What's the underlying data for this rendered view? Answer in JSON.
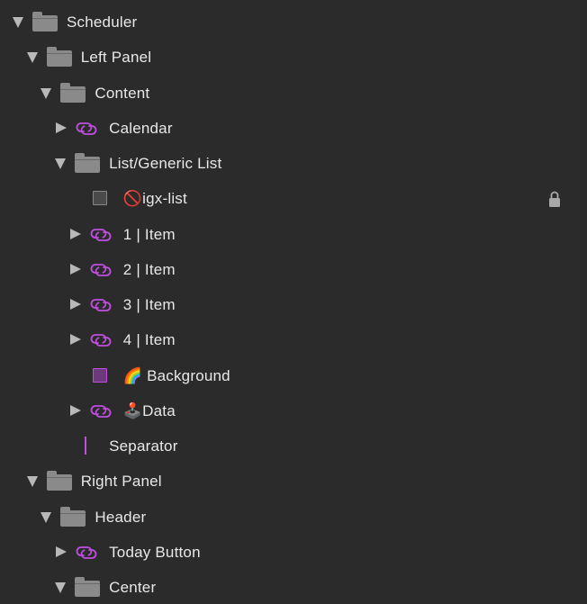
{
  "layers": [
    {
      "label": "Scheduler",
      "type": "folder",
      "state": "expanded",
      "level": 0
    },
    {
      "label": "Left Panel",
      "type": "folder",
      "state": "expanded",
      "level": 1
    },
    {
      "label": "Content",
      "type": "folder",
      "state": "expanded",
      "level": 2
    },
    {
      "label": "Calendar",
      "type": "symbol",
      "state": "collapsed",
      "level": 3
    },
    {
      "label": "List/Generic List",
      "type": "folder",
      "state": "expanded",
      "level": 3
    },
    {
      "label": "🚫igx-list",
      "type": "square",
      "state": "none",
      "level": 4,
      "locked": true
    },
    {
      "label": "1 | Item",
      "type": "symbol",
      "state": "collapsed",
      "level": 4
    },
    {
      "label": "2 | Item",
      "type": "symbol",
      "state": "collapsed",
      "level": 4
    },
    {
      "label": "3 | Item",
      "type": "symbol",
      "state": "collapsed",
      "level": 4
    },
    {
      "label": "4 | Item",
      "type": "symbol",
      "state": "collapsed",
      "level": 4
    },
    {
      "label": "🌈 Background",
      "type": "square-purple",
      "state": "none",
      "level": 4
    },
    {
      "label": "🕹️Data",
      "type": "symbol",
      "state": "collapsed",
      "level": 4
    },
    {
      "label": "Separator",
      "type": "line",
      "state": "none",
      "level": 3
    },
    {
      "label": "Right Panel",
      "type": "folder",
      "state": "expanded",
      "level": 1
    },
    {
      "label": "Header",
      "type": "folder",
      "state": "expanded",
      "level": 2
    },
    {
      "label": "Today Button",
      "type": "symbol",
      "state": "collapsed",
      "level": 3
    },
    {
      "label": "Center",
      "type": "folder",
      "state": "expanded",
      "level": 3
    }
  ],
  "colors": {
    "background": "#2b2b2b",
    "text": "#e8e8e8",
    "arrow": "#b8b8b8",
    "folder": "#8a8a8a",
    "symbol_accent": "#c04fe0",
    "lock": "#a8a8a8"
  },
  "icons": {
    "expanded": "triangle-down-icon",
    "collapsed": "triangle-right-icon",
    "folder": "folder-icon",
    "symbol": "symbol-link-icon",
    "square": "shape-square-icon",
    "line": "line-separator-icon",
    "locked": "lock-icon"
  }
}
